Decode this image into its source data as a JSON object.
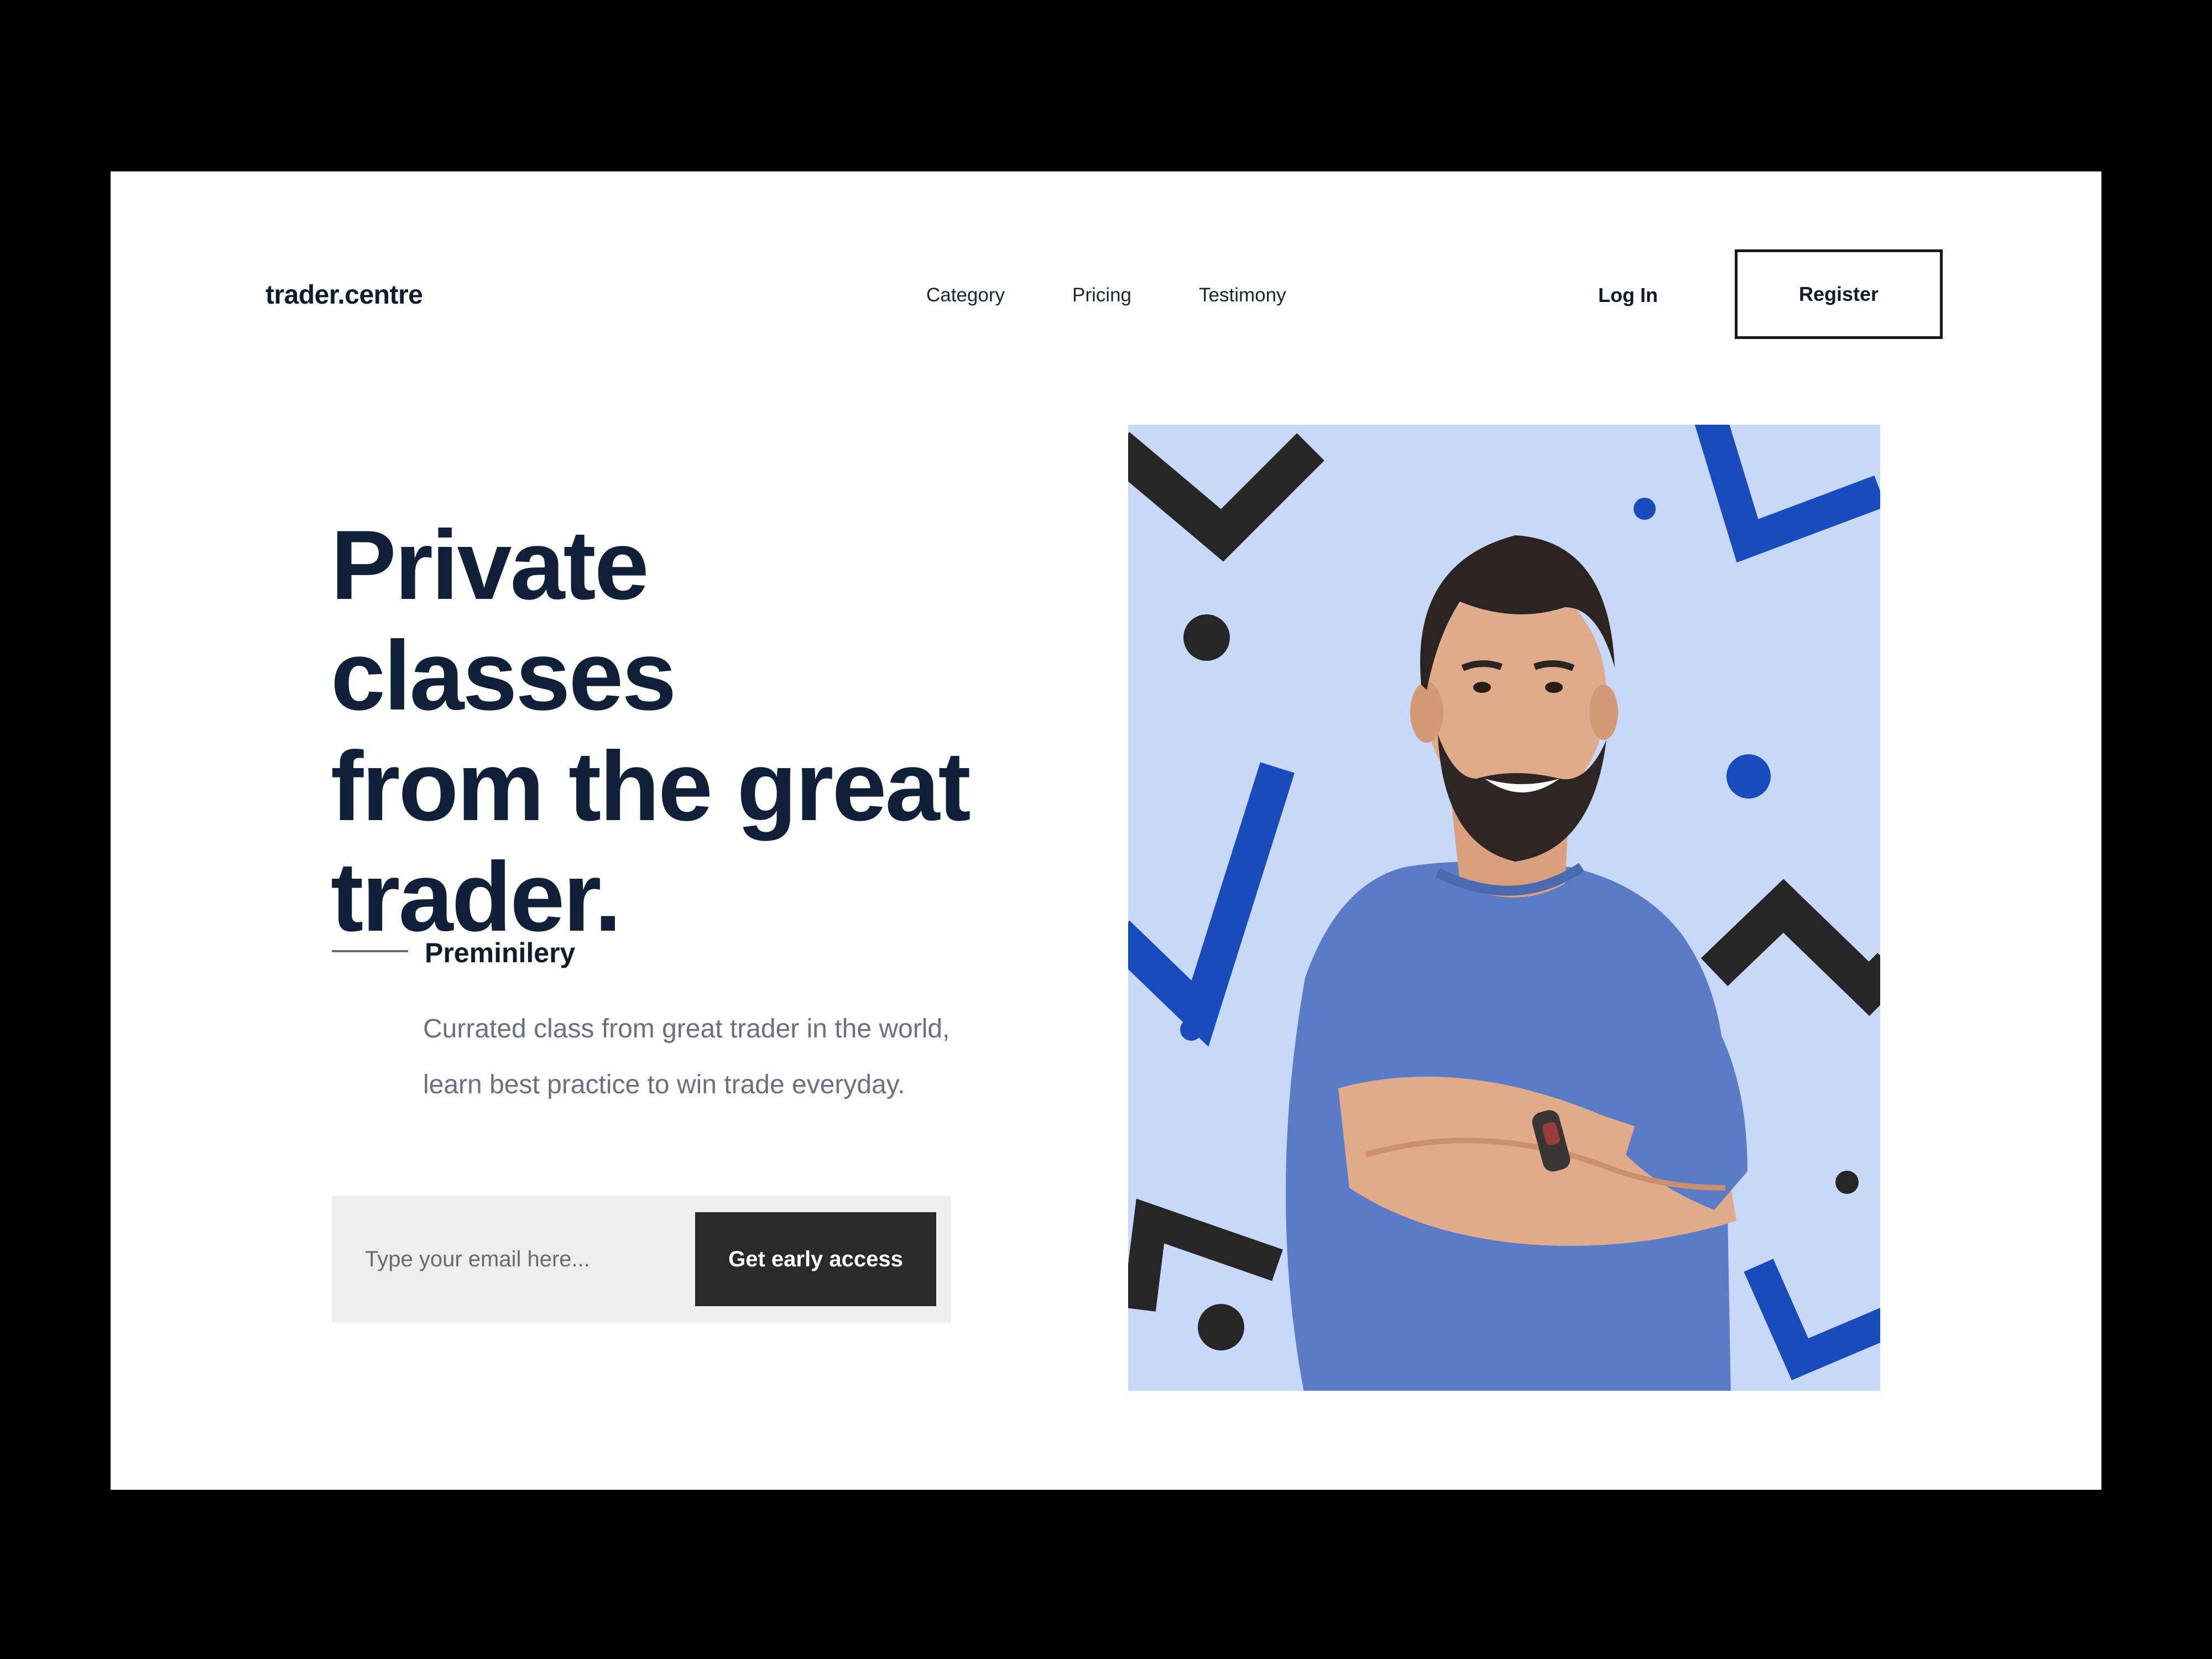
{
  "header": {
    "logo": "trader.centre",
    "nav": [
      {
        "label": "Category"
      },
      {
        "label": "Pricing"
      },
      {
        "label": "Testimony"
      }
    ],
    "login_label": "Log In",
    "register_label": "Register"
  },
  "hero": {
    "headline_lines": [
      "Private classes",
      "from the great",
      "trader."
    ],
    "subtitle": "Preminilery",
    "description_lines": [
      "Currated class from great trader in the world,",
      "learn best practice to win trade everyday."
    ],
    "email_placeholder": "Type your email here...",
    "cta_label": "Get early access"
  },
  "image": {
    "subject": "smiling bearded man in blue t-shirt with crossed arms",
    "background_color": "#c8d8f8",
    "accent_blue": "#1a4bbd",
    "accent_dark": "#262626"
  },
  "colors": {
    "frame": "#000000",
    "page": "#ffffff",
    "heading": "#0f2038",
    "body_text": "#6b6f82",
    "button_dark": "#2a2a2a",
    "form_bg": "#eeeeee"
  }
}
